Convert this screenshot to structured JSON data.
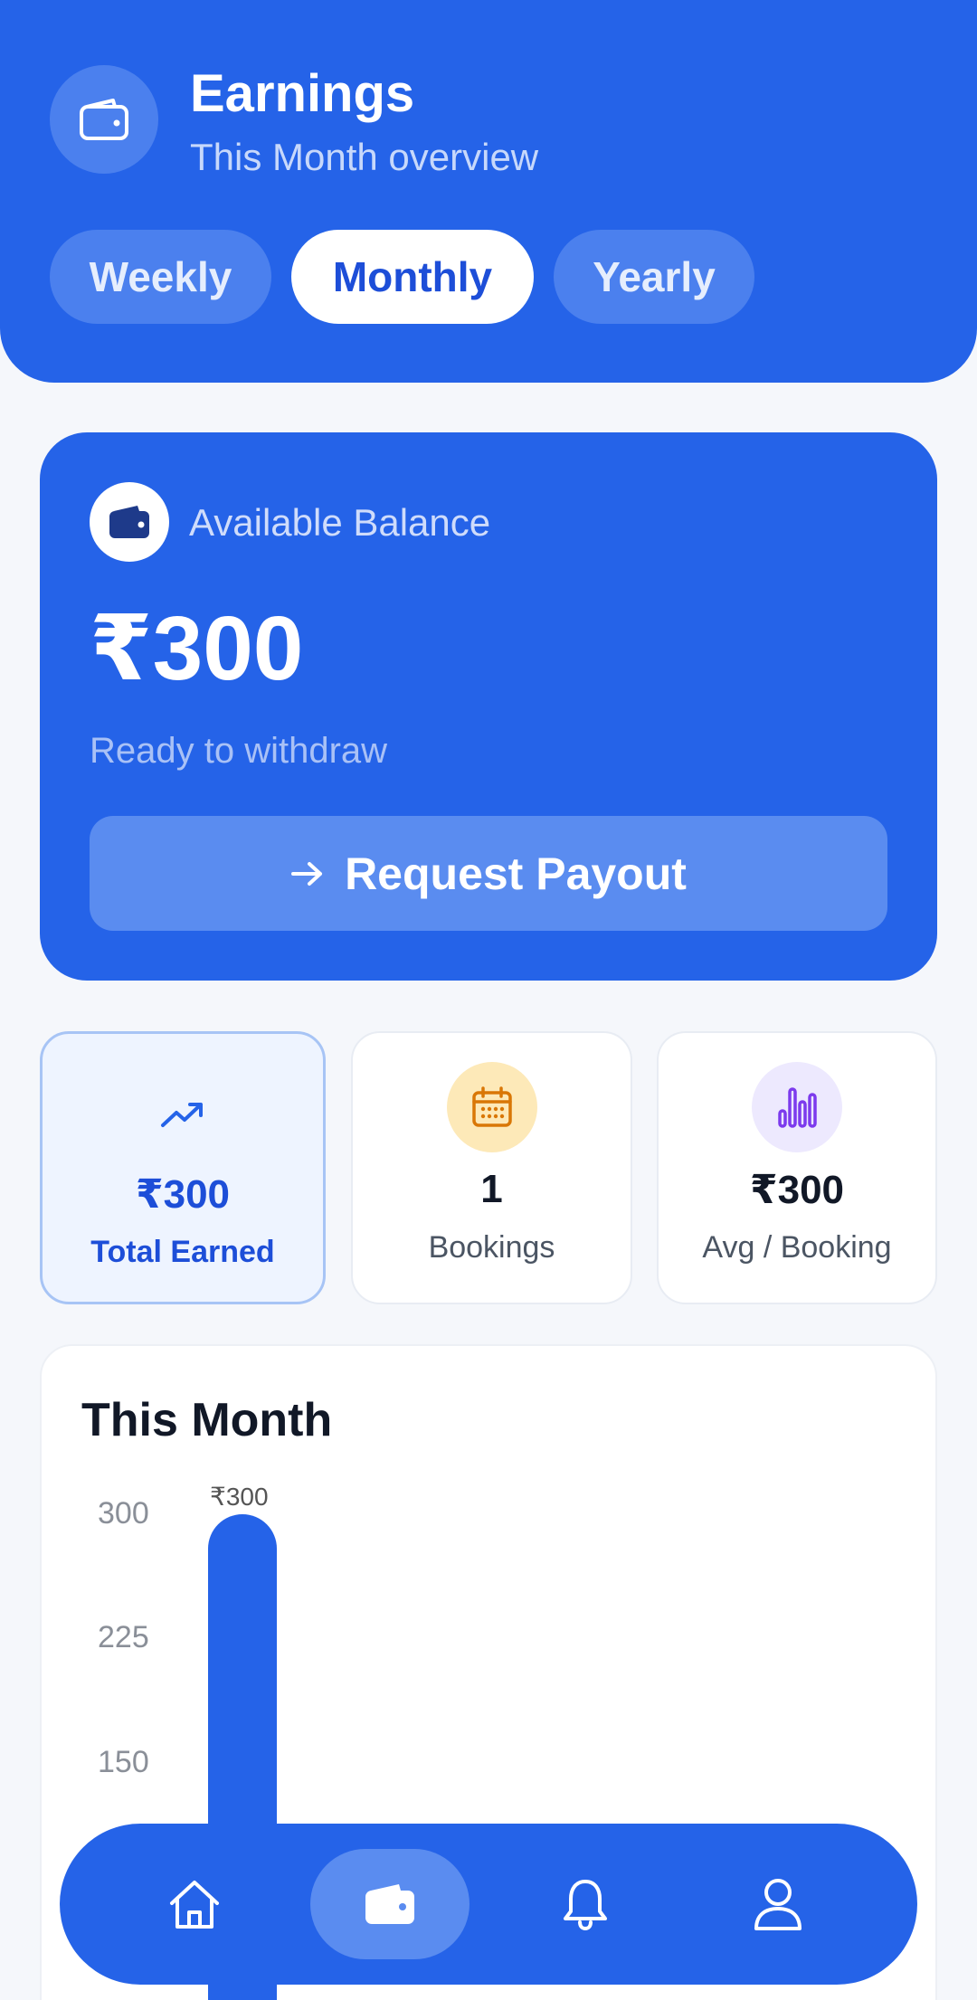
{
  "header": {
    "icon": "wallet-icon",
    "title": "Earnings",
    "subtitle": "This Month overview",
    "tabs": [
      {
        "label": "Weekly",
        "active": false
      },
      {
        "label": "Monthly",
        "active": true
      },
      {
        "label": "Yearly",
        "active": false
      }
    ]
  },
  "balance": {
    "icon": "wallet-icon",
    "label": "Available Balance",
    "amount": "₹300",
    "note": "Ready to withdraw",
    "button_icon": "arrow-right-icon",
    "button_label": "Request Payout"
  },
  "stats": [
    {
      "icon": "trending-up-icon",
      "value": "₹300",
      "label": "Total Earned"
    },
    {
      "icon": "calendar-icon",
      "value": "1",
      "label": "Bookings"
    },
    {
      "icon": "bar-chart-icon",
      "value": "₹300",
      "label": "Avg / Booking"
    }
  ],
  "chart": {
    "title": "This Month",
    "yticks": [
      "300",
      "225",
      "150"
    ]
  },
  "chart_data": {
    "type": "bar",
    "title": "This Month",
    "categories": [
      ""
    ],
    "values": [
      300
    ],
    "data_labels": [
      "₹300"
    ],
    "ylim": [
      0,
      300
    ],
    "yticks": [
      150,
      225,
      300
    ],
    "grid": false
  },
  "nav": [
    {
      "icon": "home-icon",
      "active": false
    },
    {
      "icon": "wallet-icon",
      "active": true
    },
    {
      "icon": "bell-icon",
      "active": false
    },
    {
      "icon": "user-icon",
      "active": false
    }
  ],
  "colors": {
    "primary": "#2563e8",
    "primary_light": "#4b80ee",
    "background": "#f5f7fb",
    "calendar_bg": "#fde9b8",
    "calendar_fg": "#d97706",
    "chart_icon_bg": "#ede9fe",
    "chart_icon_fg": "#7c3aed"
  }
}
